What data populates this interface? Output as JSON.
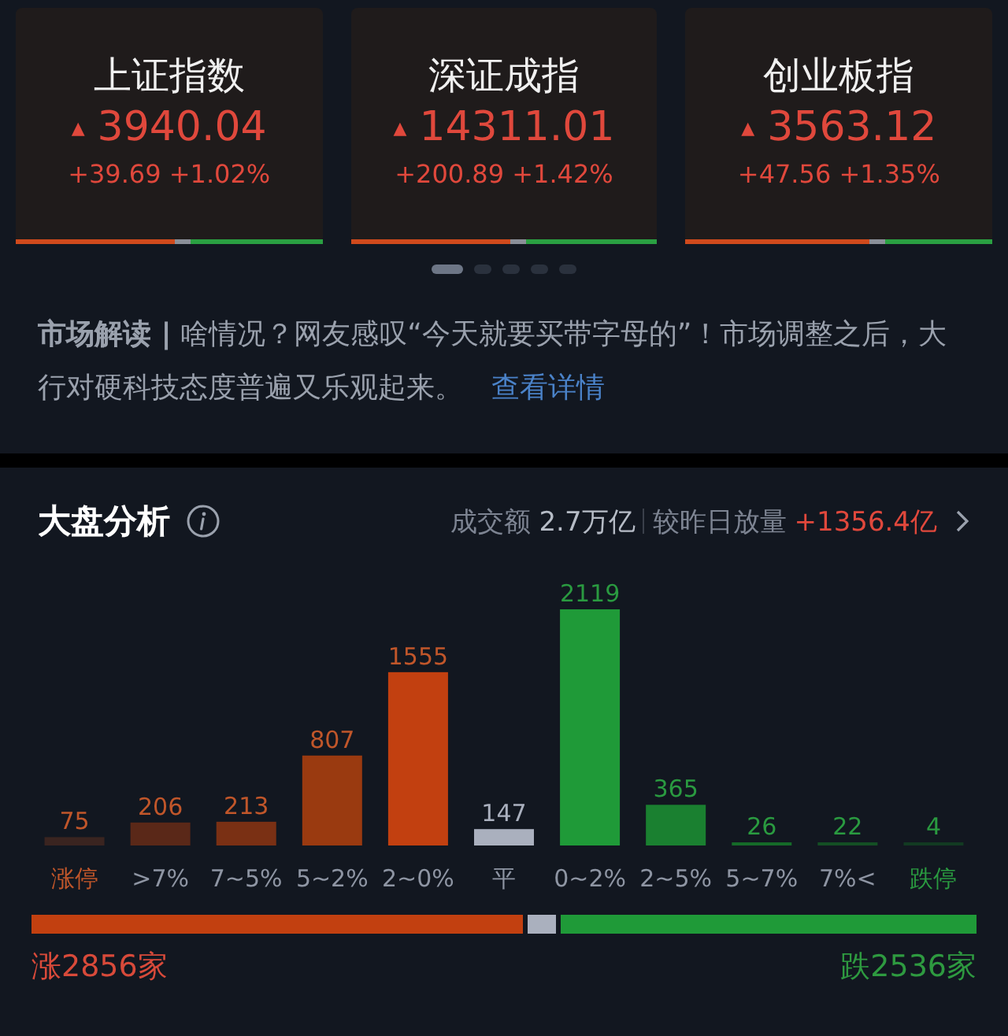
{
  "index_cards": [
    {
      "name": "上证指数",
      "arrow": "▲",
      "value": "3940.04",
      "change": "+39.69 +1.02%",
      "level": 0.52
    },
    {
      "name": "深证成指",
      "arrow": "▲",
      "value": "14311.01",
      "change": "+200.89 +1.42%",
      "level": 0.52
    },
    {
      "name": "创业板指",
      "arrow": "▲",
      "value": "3563.12",
      "change": "+47.56 +1.35%",
      "level": 0.6
    }
  ],
  "pager": [
    {
      "selected": true
    },
    {
      "selected": false
    },
    {
      "selected": false
    },
    {
      "selected": false
    },
    {
      "selected": false
    }
  ],
  "market_news": {
    "text": "**市场解读 |** 啥情况？网友感叹“今天就要买带字母的”！市场调整之后，大行对硬科技态度普遍又乐观起来。",
    "link": "查看详情"
  },
  "market_analysis": {
    "title": "大盘分析",
    "turnover_label": "成交额",
    "turnover": "2.7万亿",
    "compare_label": "较昨日放量",
    "compare_value": "+1356.4亿",
    "chart_data": {
      "type": "bar",
      "categories": [
        "涨停",
        ">7%",
        "7~5%",
        "5~2%",
        "2~0%",
        "平",
        "0~2%",
        "2~5%",
        "5~7%",
        "7%<",
        "跌停"
      ],
      "values": [
        75,
        206,
        213,
        807,
        1555,
        147,
        2119,
        365,
        26,
        22,
        4
      ],
      "data_labels": true
    },
    "breadth_bar": {
      "level": 0.52
    },
    "up_total": "涨2856家",
    "down_total": "跌2536家"
  }
}
